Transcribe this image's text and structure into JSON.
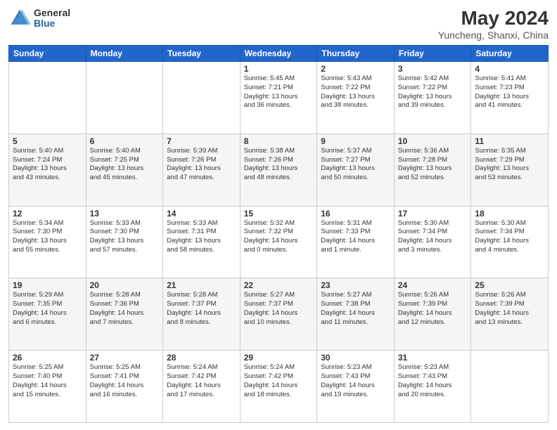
{
  "header": {
    "logo_general": "General",
    "logo_blue": "Blue",
    "title": "May 2024",
    "subtitle": "Yuncheng, Shanxi, China"
  },
  "weekdays": [
    "Sunday",
    "Monday",
    "Tuesday",
    "Wednesday",
    "Thursday",
    "Friday",
    "Saturday"
  ],
  "weeks": [
    {
      "days": [
        {
          "num": "",
          "detail": ""
        },
        {
          "num": "",
          "detail": ""
        },
        {
          "num": "",
          "detail": ""
        },
        {
          "num": "1",
          "detail": "Sunrise: 5:45 AM\nSunset: 7:21 PM\nDaylight: 13 hours\nand 36 minutes."
        },
        {
          "num": "2",
          "detail": "Sunrise: 5:43 AM\nSunset: 7:22 PM\nDaylight: 13 hours\nand 38 minutes."
        },
        {
          "num": "3",
          "detail": "Sunrise: 5:42 AM\nSunset: 7:22 PM\nDaylight: 13 hours\nand 39 minutes."
        },
        {
          "num": "4",
          "detail": "Sunrise: 5:41 AM\nSunset: 7:23 PM\nDaylight: 13 hours\nand 41 minutes."
        }
      ]
    },
    {
      "days": [
        {
          "num": "5",
          "detail": "Sunrise: 5:40 AM\nSunset: 7:24 PM\nDaylight: 13 hours\nand 43 minutes."
        },
        {
          "num": "6",
          "detail": "Sunrise: 5:40 AM\nSunset: 7:25 PM\nDaylight: 13 hours\nand 45 minutes."
        },
        {
          "num": "7",
          "detail": "Sunrise: 5:39 AM\nSunset: 7:26 PM\nDaylight: 13 hours\nand 47 minutes."
        },
        {
          "num": "8",
          "detail": "Sunrise: 5:38 AM\nSunset: 7:26 PM\nDaylight: 13 hours\nand 48 minutes."
        },
        {
          "num": "9",
          "detail": "Sunrise: 5:37 AM\nSunset: 7:27 PM\nDaylight: 13 hours\nand 50 minutes."
        },
        {
          "num": "10",
          "detail": "Sunrise: 5:36 AM\nSunset: 7:28 PM\nDaylight: 13 hours\nand 52 minutes."
        },
        {
          "num": "11",
          "detail": "Sunrise: 5:35 AM\nSunset: 7:29 PM\nDaylight: 13 hours\nand 53 minutes."
        }
      ]
    },
    {
      "days": [
        {
          "num": "12",
          "detail": "Sunrise: 5:34 AM\nSunset: 7:30 PM\nDaylight: 13 hours\nand 55 minutes."
        },
        {
          "num": "13",
          "detail": "Sunrise: 5:33 AM\nSunset: 7:30 PM\nDaylight: 13 hours\nand 57 minutes."
        },
        {
          "num": "14",
          "detail": "Sunrise: 5:33 AM\nSunset: 7:31 PM\nDaylight: 13 hours\nand 58 minutes."
        },
        {
          "num": "15",
          "detail": "Sunrise: 5:32 AM\nSunset: 7:32 PM\nDaylight: 14 hours\nand 0 minutes."
        },
        {
          "num": "16",
          "detail": "Sunrise: 5:31 AM\nSunset: 7:33 PM\nDaylight: 14 hours\nand 1 minute."
        },
        {
          "num": "17",
          "detail": "Sunrise: 5:30 AM\nSunset: 7:34 PM\nDaylight: 14 hours\nand 3 minutes."
        },
        {
          "num": "18",
          "detail": "Sunrise: 5:30 AM\nSunset: 7:34 PM\nDaylight: 14 hours\nand 4 minutes."
        }
      ]
    },
    {
      "days": [
        {
          "num": "19",
          "detail": "Sunrise: 5:29 AM\nSunset: 7:35 PM\nDaylight: 14 hours\nand 6 minutes."
        },
        {
          "num": "20",
          "detail": "Sunrise: 5:28 AM\nSunset: 7:36 PM\nDaylight: 14 hours\nand 7 minutes."
        },
        {
          "num": "21",
          "detail": "Sunrise: 5:28 AM\nSunset: 7:37 PM\nDaylight: 14 hours\nand 8 minutes."
        },
        {
          "num": "22",
          "detail": "Sunrise: 5:27 AM\nSunset: 7:37 PM\nDaylight: 14 hours\nand 10 minutes."
        },
        {
          "num": "23",
          "detail": "Sunrise: 5:27 AM\nSunset: 7:38 PM\nDaylight: 14 hours\nand 11 minutes."
        },
        {
          "num": "24",
          "detail": "Sunrise: 5:26 AM\nSunset: 7:39 PM\nDaylight: 14 hours\nand 12 minutes."
        },
        {
          "num": "25",
          "detail": "Sunrise: 5:26 AM\nSunset: 7:39 PM\nDaylight: 14 hours\nand 13 minutes."
        }
      ]
    },
    {
      "days": [
        {
          "num": "26",
          "detail": "Sunrise: 5:25 AM\nSunset: 7:40 PM\nDaylight: 14 hours\nand 15 minutes."
        },
        {
          "num": "27",
          "detail": "Sunrise: 5:25 AM\nSunset: 7:41 PM\nDaylight: 14 hours\nand 16 minutes."
        },
        {
          "num": "28",
          "detail": "Sunrise: 5:24 AM\nSunset: 7:42 PM\nDaylight: 14 hours\nand 17 minutes."
        },
        {
          "num": "29",
          "detail": "Sunrise: 5:24 AM\nSunset: 7:42 PM\nDaylight: 14 hours\nand 18 minutes."
        },
        {
          "num": "30",
          "detail": "Sunrise: 5:23 AM\nSunset: 7:43 PM\nDaylight: 14 hours\nand 19 minutes."
        },
        {
          "num": "31",
          "detail": "Sunrise: 5:23 AM\nSunset: 7:43 PM\nDaylight: 14 hours\nand 20 minutes."
        },
        {
          "num": "",
          "detail": ""
        }
      ]
    }
  ]
}
